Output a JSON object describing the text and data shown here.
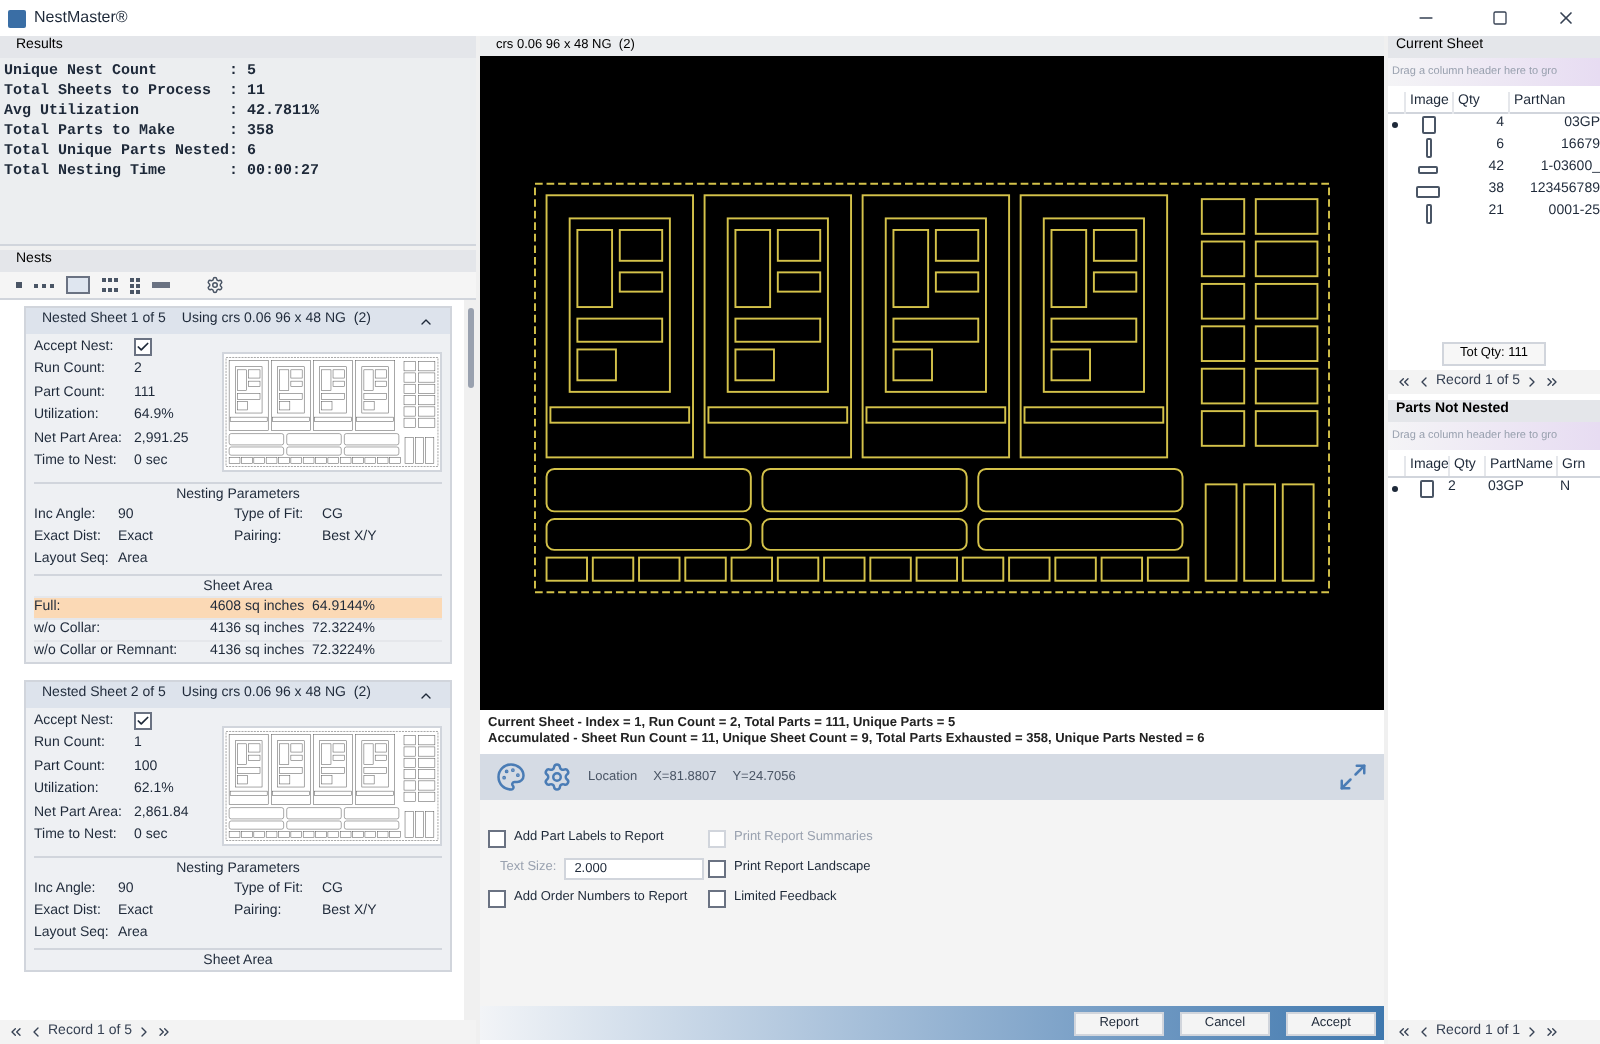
{
  "window": {
    "title": "NestMaster®"
  },
  "results": {
    "title": "Results",
    "lines": [
      "Unique Nest Count        : 5",
      "Total Sheets to Process  : 11",
      "Avg Utilization          : 42.7811%",
      "Total Parts to Make      : 358",
      "Total Unique Parts Nested: 6",
      "Total Nesting Time       : 00:00:27"
    ]
  },
  "nests": {
    "title": "Nests",
    "record": "Record 1 of 5",
    "sheets": [
      {
        "header": "Nested Sheet 1 of 5",
        "using": "Using crs 0.06 96 x 48 NG  (2)",
        "expanded": true,
        "accept_label": "Accept Nest:",
        "accepted": true,
        "stats": [
          {
            "label": "Run Count:",
            "value": "2"
          },
          {
            "label": "Part Count:",
            "value": "111"
          },
          {
            "label": "Utilization:",
            "value": "64.9%"
          },
          {
            "label": "Net Part Area:",
            "value": "2,991.25"
          },
          {
            "label": "Time to Nest:",
            "value": "0 sec"
          }
        ],
        "params_title": "Nesting Parameters",
        "params": [
          {
            "label": "Inc Angle:",
            "value": "90"
          },
          {
            "label": "Type of Fit:",
            "value": "CG"
          },
          {
            "label": "Exact Dist:",
            "value": "Exact"
          },
          {
            "label": "Pairing:",
            "value": "Best X/Y"
          },
          {
            "label": "Layout Seq:",
            "value": "Area"
          }
        ],
        "area_title": "Sheet Area",
        "areas": [
          {
            "label": "Full:",
            "value": "4608 sq inches  64.9144%",
            "highlighted": true
          },
          {
            "label": "w/o Collar:",
            "value": "4136 sq inches  72.3224%",
            "highlighted": false
          },
          {
            "label": "w/o Collar or Remnant:",
            "value": "4136 sq inches  72.3224%",
            "highlighted": false
          }
        ]
      },
      {
        "header": "Nested Sheet 2 of 5",
        "using": "Using crs 0.06 96 x 48 NG  (2)",
        "expanded": true,
        "accept_label": "Accept Nest:",
        "accepted": true,
        "stats": [
          {
            "label": "Run Count:",
            "value": "1"
          },
          {
            "label": "Part Count:",
            "value": "100"
          },
          {
            "label": "Utilization:",
            "value": "62.1%"
          },
          {
            "label": "Net Part Area:",
            "value": "2,861.84"
          },
          {
            "label": "Time to Nest:",
            "value": "0 sec"
          }
        ],
        "params_title": "Nesting Parameters",
        "params": [
          {
            "label": "Inc Angle:",
            "value": "90"
          },
          {
            "label": "Type of Fit:",
            "value": "CG"
          },
          {
            "label": "Exact Dist:",
            "value": "Exact"
          },
          {
            "label": "Pairing:",
            "value": "Best X/Y"
          },
          {
            "label": "Layout Seq:",
            "value": "Area"
          }
        ],
        "area_title": "Sheet Area"
      }
    ]
  },
  "canvas": {
    "title": "crs 0.06 96 x 48 NG  (2)",
    "info": [
      "Current Sheet - Index = 1, Run Count = 2, Total Parts = 111, Unique Parts = 5",
      "Accumulated - Sheet Run Count = 11, Unique Sheet Count = 9, Total Parts Exhausted = 358, Unique Parts Nested = 6"
    ],
    "location_label": "Location",
    "x": "X=81.8807",
    "y": "Y=24.7056"
  },
  "options": [
    {
      "kind": "checkbox",
      "label": "Add Part Labels to Report",
      "checked": false,
      "disabled": false
    },
    {
      "kind": "checkbox",
      "label": "Print Report Summaries",
      "checked": false,
      "disabled": true
    },
    {
      "kind": "field",
      "label": "Text Size:",
      "value": "2.000"
    },
    {
      "kind": "checkbox",
      "label": "Print Report Landscape",
      "checked": false,
      "disabled": false
    },
    {
      "kind": "checkbox",
      "label": "Add Order Numbers to Report",
      "checked": false,
      "disabled": false
    },
    {
      "kind": "checkbox",
      "label": "Limited Feedback",
      "checked": false,
      "disabled": false
    }
  ],
  "buttons": [
    "Report",
    "Cancel",
    "Accept"
  ],
  "current_sheet": {
    "title": "Current Sheet",
    "group_hint": "Drag a column header here to gro",
    "columns": [
      "Image",
      "Qty",
      "PartNan"
    ],
    "rows": [
      {
        "kind": "tall",
        "qty": "4",
        "name": "03GP",
        "current": true
      },
      {
        "kind": "thin",
        "qty": "6",
        "name": "16679",
        "current": false
      },
      {
        "kind": "slot",
        "qty": "42",
        "name": "1-03600_",
        "current": false
      },
      {
        "kind": "wide",
        "qty": "38",
        "name": "123456789",
        "current": false
      },
      {
        "kind": "thin",
        "qty": "21",
        "name": "0001-25",
        "current": false
      }
    ],
    "total": "Tot Qty: 111",
    "record": "Record 1 of 5"
  },
  "parts_not_nested": {
    "title": "Parts Not Nested",
    "group_hint": "Drag a column header here to gro",
    "columns": [
      "Image",
      "Qty",
      "PartName",
      "Grn"
    ],
    "rows": [
      {
        "kind": "tall",
        "qty": "2",
        "name": "03GP",
        "grain": "N",
        "current": true
      }
    ],
    "record": "Record 1 of 1"
  }
}
